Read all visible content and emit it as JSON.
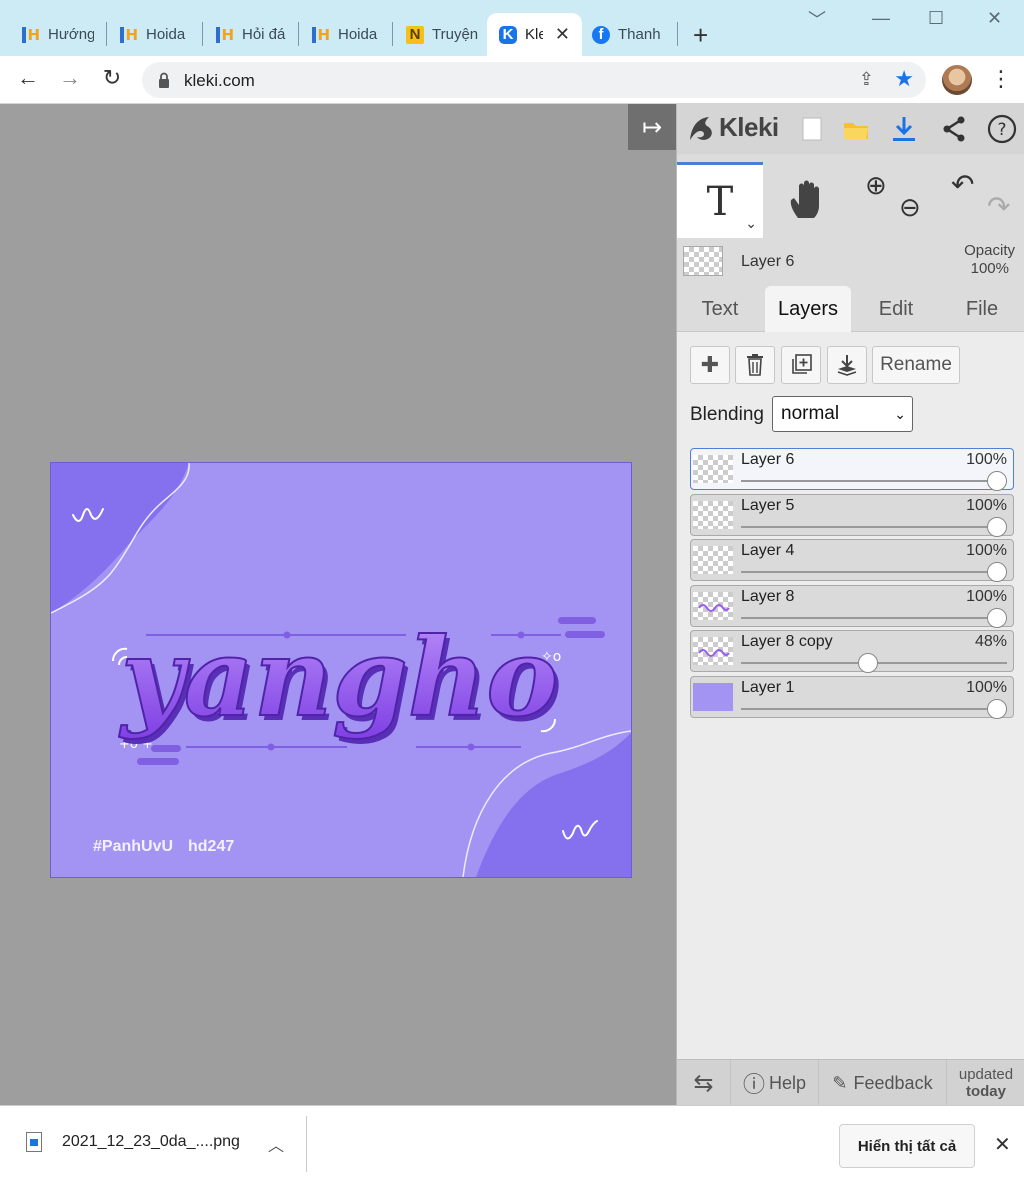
{
  "browser": {
    "tabs": [
      {
        "title": "Hướng",
        "icon": "hoidap-icon"
      },
      {
        "title": "Hoida",
        "icon": "hoidap-icon"
      },
      {
        "title": "Hỏi đá",
        "icon": "hoidap-icon"
      },
      {
        "title": "Hoida",
        "icon": "hoidap-icon"
      },
      {
        "title": "Truyện",
        "icon": "novel-icon"
      },
      {
        "title": "Kle",
        "icon": "kleki-icon",
        "active": true
      },
      {
        "title": "Thanh",
        "icon": "facebook-icon"
      }
    ],
    "new_tab": "+",
    "url": "kleki.com",
    "accent": "#1a73e8"
  },
  "kleki": {
    "brand": "Kleki",
    "current_layer": "Layer 6",
    "opacity_label": "Opacity",
    "opacity_value": "100%",
    "tabs": [
      "Text",
      "Layers",
      "Edit",
      "File"
    ],
    "active_tab": "Layers",
    "rename_label": "Rename",
    "blending_label": "Blending",
    "blending_value": "normal",
    "layers": [
      {
        "name": "Layer 6",
        "opacity": "100%",
        "level": 1.0,
        "selected": true
      },
      {
        "name": "Layer 5",
        "opacity": "100%",
        "level": 1.0
      },
      {
        "name": "Layer 4",
        "opacity": "100%",
        "level": 1.0
      },
      {
        "name": "Layer 8",
        "opacity": "100%",
        "level": 1.0
      },
      {
        "name": "Layer 8 copy",
        "opacity": "48%",
        "level": 0.48
      },
      {
        "name": "Layer 1",
        "opacity": "100%",
        "level": 1.0
      }
    ],
    "footer": {
      "help": "Help",
      "feedback": "Feedback",
      "updated_1": "updated",
      "updated_2": "today"
    }
  },
  "artwork": {
    "main_text": "yangho",
    "credit_1": "#PanhUvU",
    "credit_2": "hd247",
    "colors": {
      "bg": "#a394f3",
      "accent": "#8570ee",
      "letters": "#9a5cf0"
    }
  },
  "download": {
    "filename": "2021_12_23_0da_....png",
    "show_all": "Hiển thị tất cả"
  }
}
